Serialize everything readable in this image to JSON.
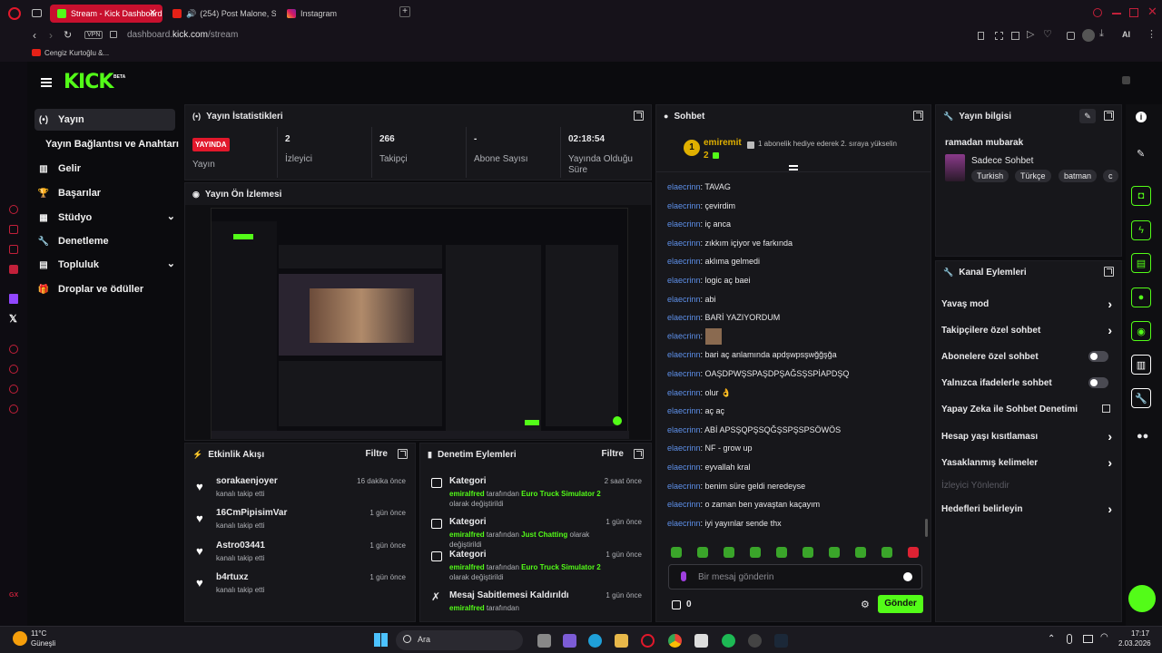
{
  "browser": {
    "tabs": [
      {
        "label": "Stream - Kick Dashboard",
        "active": true
      },
      {
        "label": "(254) Post Malone, Sw",
        "active": false
      },
      {
        "label": "Instagram",
        "active": false
      }
    ],
    "address": {
      "domain_prefix": "dashboard.",
      "domain": "kick.com",
      "path": "/stream",
      "vpn": "VPN"
    },
    "bookmark": "Cengiz Kurtoğlu &...",
    "ai_label": "AI"
  },
  "kick": {
    "logo": "KICK",
    "logo_badge": "BETA",
    "nav": [
      {
        "label": "Yayın",
        "icon": "broadcast-icon"
      },
      {
        "label": "Yayın Bağlantısı ve Anahtarı",
        "icon": ""
      },
      {
        "label": "Gelir",
        "icon": "chart-icon"
      },
      {
        "label": "Başarılar",
        "icon": "trophy-icon"
      },
      {
        "label": "Stüdyo",
        "icon": "studio-icon"
      },
      {
        "label": "Denetleme",
        "icon": "wrench-icon"
      },
      {
        "label": "Topluluk",
        "icon": "community-icon"
      },
      {
        "label": "Droplar ve ödüller",
        "icon": "gift-icon"
      }
    ],
    "stats": {
      "title": "Yayın İstatistikleri",
      "live_badge": "YAYINDA",
      "live_label": "Yayın",
      "items": [
        {
          "value": "2",
          "label": "İzleyici"
        },
        {
          "value": "266",
          "label": "Takipçi"
        },
        {
          "value": "-",
          "label": "Abone Sayısı"
        },
        {
          "value": "02:18:54",
          "label": "Yayında Olduğu Süre"
        }
      ]
    },
    "preview": {
      "title": "Yayın Ön İzlemesi"
    },
    "activity": {
      "title": "Etkinlik Akışı",
      "filter": "Filtre",
      "items": [
        {
          "name": "sorakaenjoyer",
          "sub": "kanalı takip etti",
          "time": "16 dakika önce"
        },
        {
          "name": "16CmPipisimVar",
          "sub": "kanalı takip etti",
          "time": "1 gün önce"
        },
        {
          "name": "Astro03441",
          "sub": "kanalı takip etti",
          "time": "1 gün önce"
        },
        {
          "name": "b4rtuxz",
          "sub": "kanalı takip etti",
          "time": "1 gün önce"
        }
      ]
    },
    "moderation": {
      "title": "Denetim Eylemleri",
      "filter": "Filtre",
      "items": [
        {
          "name": "Kategori",
          "user": "emiralfred",
          "mid": " tarafından ",
          "game": "Euro Truck Simulator 2",
          "end": " olarak değiştirildi",
          "time": "2 saat önce"
        },
        {
          "name": "Kategori",
          "user": "emiralfred",
          "mid": " tarafından ",
          "game": "Just Chatting",
          "end": " olarak değiştirildi",
          "time": "1 gün önce"
        },
        {
          "name": "Kategori",
          "user": "emiralfred",
          "mid": " tarafından ",
          "game": "Euro Truck Simulator 2",
          "end": " olarak değiştirildi",
          "time": "1 gün önce"
        },
        {
          "name": "Mesaj Sabitlemesi Kaldırıldı",
          "user": "emiralfred",
          "mid": " tarafından",
          "game": "",
          "end": "",
          "time": "1 gün önce"
        }
      ]
    },
    "chat": {
      "title": "Sohbet",
      "pinned_user": "emiremit",
      "pinned_rank": "1",
      "pinned_count": "2",
      "pinned_msg": "1 abonelik hediye ederek 2. sıraya yükselin",
      "messages": [
        {
          "user": "elaecrinn",
          "text": ": TAVAG"
        },
        {
          "user": "elaecrinn",
          "text": ": çevirdim"
        },
        {
          "user": "elaecrinn",
          "text": ": iç anca"
        },
        {
          "user": "elaecrinn",
          "text": ": zıkkım içiyor ve farkında"
        },
        {
          "user": "elaecrinn",
          "text": ": aklıma gelmedi"
        },
        {
          "user": "elaecrinn",
          "text": ": logic aç baei"
        },
        {
          "user": "elaecrinn",
          "text": ": abi"
        },
        {
          "user": "elaecrinn",
          "text": ": BARİ YAZIYORDUM"
        },
        {
          "user": "elaecrinn",
          "text": ": "
        },
        {
          "user": "elaecrinn",
          "text": ": bari aç anlamında apdşwpsşwğğşğa"
        },
        {
          "user": "elaecrinn",
          "text": ": OAŞDPWŞSPAŞDPŞAĞSŞSPİAPDŞQ"
        },
        {
          "user": "elaecrinn",
          "text": ": olur 👌"
        },
        {
          "user": "elaecrinn",
          "text": ": aç aç"
        },
        {
          "user": "elaecrinn",
          "text": ": ABİ APSŞQPŞSQĞŞSPŞSPSÖWÖS"
        },
        {
          "user": "elaecrinn",
          "text": ": NF - grow up"
        },
        {
          "user": "elaecrinn",
          "text": ": eyvallah kral"
        },
        {
          "user": "elaecrinn",
          "text": ": benim süre geldi neredeyse"
        },
        {
          "user": "elaecrinn",
          "text": ": o zaman ben yavaştan kaçayım"
        },
        {
          "user": "elaecrinn",
          "text": ": iyi yayınlar sende thx"
        }
      ],
      "input_placeholder": "Bir mesaj gönderin",
      "points": "0",
      "send": "Gönder"
    },
    "info": {
      "title": "Yayın bilgisi",
      "stream_title": "ramadan mubarak",
      "category": "Sadece Sohbet",
      "tags": [
        "Turkish",
        "Türkçe",
        "batman",
        "c"
      ]
    },
    "channel_actions": {
      "title": "Kanal Eylemleri",
      "items": [
        {
          "label": "Yavaş mod",
          "kind": "chevron"
        },
        {
          "label": "Takipçilere özel sohbet",
          "kind": "chevron"
        },
        {
          "label": "Abonelere özel sohbet",
          "kind": "toggle"
        },
        {
          "label": "Yalnızca ifadelerle sohbet",
          "kind": "toggle"
        },
        {
          "label": "Yapay Zeka ile Sohbet Denetimi",
          "kind": "external"
        },
        {
          "label": "Hesap yaşı kısıtlaması",
          "kind": "chevron"
        },
        {
          "label": "Yasaklanmış kelimeler",
          "kind": "chevron"
        },
        {
          "label": "İzleyici Yönlendir",
          "kind": "disabled"
        },
        {
          "label": "Hedefleri belirleyin",
          "kind": "chevron"
        }
      ]
    }
  },
  "taskbar": {
    "weather": "11°C",
    "weather_desc": "Güneşli",
    "search": "Ara",
    "time": "17:17",
    "date": "2.03.2026"
  },
  "colors": {
    "accent": "#53fc18",
    "live": "#e2182b",
    "opera": "#c2203a",
    "chat_user": "#5d8fe8"
  }
}
